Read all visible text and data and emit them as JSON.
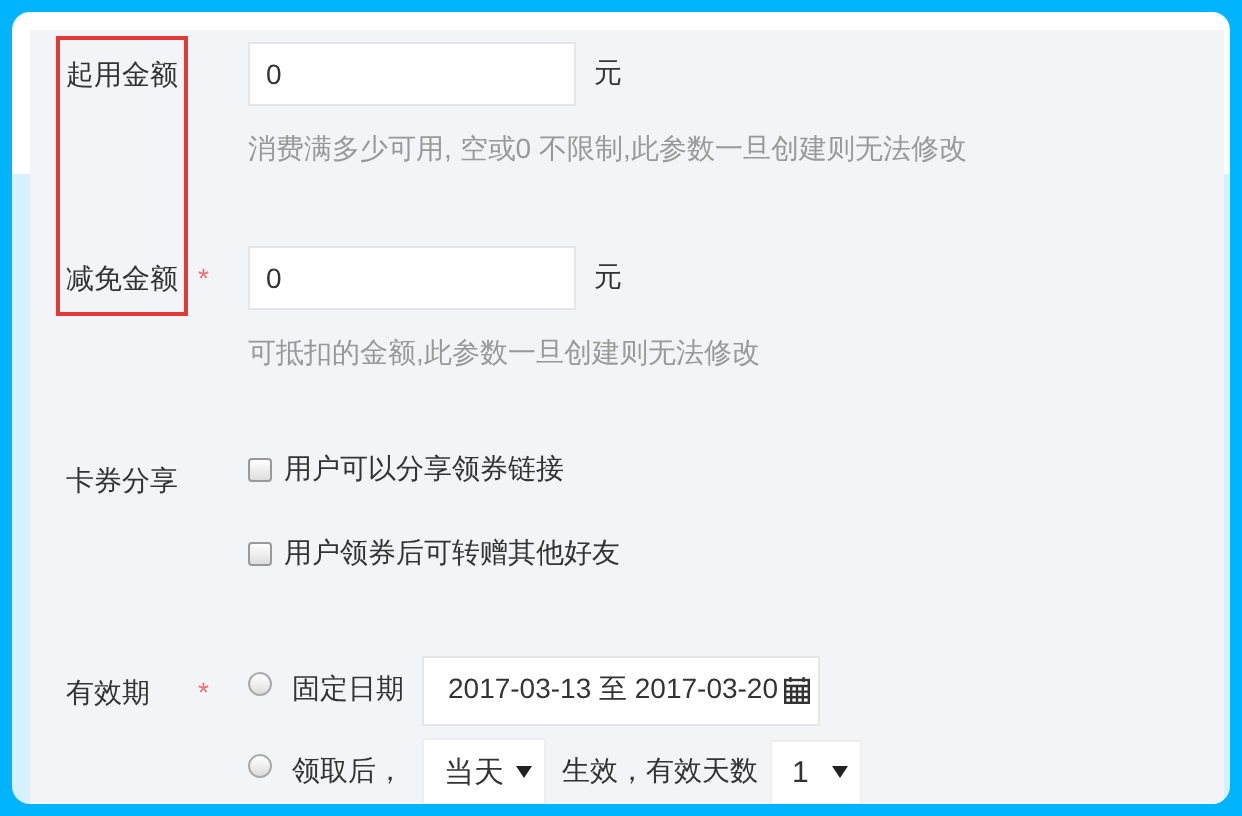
{
  "rows": [
    {
      "kind": "amount",
      "label": "起用金额",
      "required": false,
      "highlighted": true,
      "value": "0",
      "unit": "元",
      "hint": "消费满多少可用, 空或0 不限制,此参数一旦创建则无法修改"
    },
    {
      "kind": "amount",
      "label": "减免金额",
      "required": true,
      "required_mark": "*",
      "highlighted": true,
      "value": "0",
      "unit": "元",
      "hint": "可抵扣的金额,此参数一旦创建则无法修改"
    },
    {
      "kind": "checks",
      "label": "卡券分享",
      "required": false,
      "highlighted": false,
      "options": [
        {
          "label": "用户可以分享领券链接",
          "checked": false
        },
        {
          "label": "用户领券后可转赠其他好友",
          "checked": false
        }
      ]
    },
    {
      "kind": "validity",
      "label": "有效期",
      "required": true,
      "required_mark": "*",
      "highlighted": false,
      "options": [
        {
          "kind": "date-range",
          "label": "固定日期",
          "selected": false,
          "value": "2017-03-13 至 2017-03-20"
        },
        {
          "kind": "relative",
          "label": "领取后，",
          "selected": false,
          "start": "当天",
          "middle": "生效，有效天数",
          "days": "1"
        }
      ]
    }
  ]
}
